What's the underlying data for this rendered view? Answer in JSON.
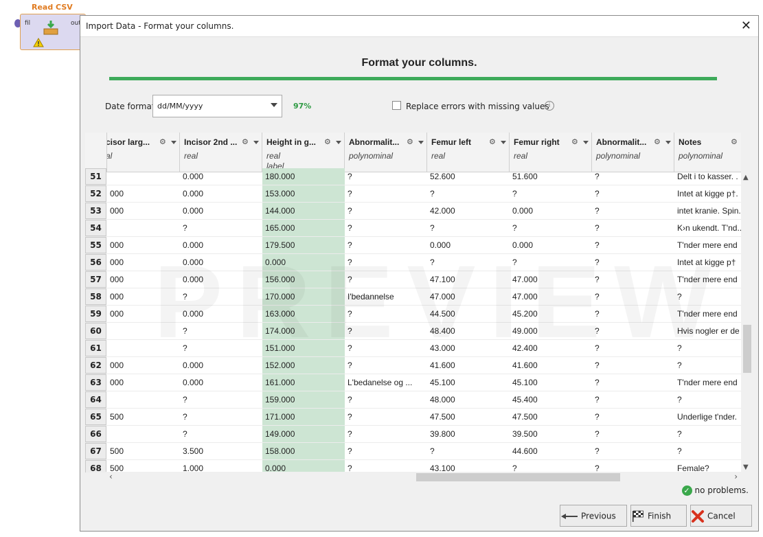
{
  "operator": {
    "title": "Read CSV",
    "port_in": "fil",
    "port_out": "out"
  },
  "dialog": {
    "title": "Import Data - Format your columns.",
    "step_title": "Format your columns.",
    "date_format_label": "Date format",
    "date_format_value": "dd/MM/yyyy",
    "match_percent": "97%",
    "replace_errors_label": "Replace errors with missing values",
    "watermark": "PREVIEW",
    "status_text": "no problems.",
    "buttons": {
      "previous": "Previous",
      "finish": "Finish",
      "cancel": "Cancel"
    }
  },
  "columns": [
    {
      "name": "cisor larg...",
      "type": "al",
      "role": ""
    },
    {
      "name": "Incisor 2nd ...",
      "type": "real",
      "role": ""
    },
    {
      "name": "Height in g...",
      "type": "real",
      "role": "label"
    },
    {
      "name": "Abnormalit...",
      "type": "polynominal",
      "role": ""
    },
    {
      "name": "Femur left",
      "type": "real",
      "role": ""
    },
    {
      "name": "Femur right",
      "type": "real",
      "role": ""
    },
    {
      "name": "Abnormalit...",
      "type": "polynominal",
      "role": ""
    },
    {
      "name": "Notes",
      "type": "polynominal",
      "role": ""
    }
  ],
  "rows": [
    {
      "n": "51",
      "c": [
        "",
        "0.000",
        "180.000",
        "?",
        "52.600",
        "51.600",
        "?",
        "Delt i to kasser. ."
      ]
    },
    {
      "n": "52",
      "c": [
        "000",
        "0.000",
        "153.000",
        "?",
        "?",
        "?",
        "?",
        "Intet at kigge p†. I"
      ]
    },
    {
      "n": "53",
      "c": [
        "000",
        "0.000",
        "144.000",
        "?",
        "42.000",
        "0.000",
        "?",
        "intet kranie. Spin."
      ]
    },
    {
      "n": "54",
      "c": [
        "",
        "?",
        "165.000",
        "?",
        "?",
        "?",
        "?",
        "K›n ukendt. T'nd.."
      ]
    },
    {
      "n": "55",
      "c": [
        "000",
        "0.000",
        "179.500",
        "?",
        "0.000",
        "0.000",
        "?",
        "T'nder mere end"
      ]
    },
    {
      "n": "56",
      "c": [
        "000",
        "0.000",
        "0.000",
        "?",
        "?",
        "?",
        "?",
        "Intet at kigge p†"
      ]
    },
    {
      "n": "57",
      "c": [
        "000",
        "0.000",
        "156.000",
        "?",
        "47.100",
        "47.000",
        "?",
        "T'nder mere end"
      ]
    },
    {
      "n": "58",
      "c": [
        "000",
        "?",
        "170.000",
        "I'bedannelse",
        "47.000",
        "47.000",
        "?",
        "?"
      ]
    },
    {
      "n": "59",
      "c": [
        "000",
        "0.000",
        "163.000",
        "?",
        "44.500",
        "45.200",
        "?",
        "T'nder mere end"
      ]
    },
    {
      "n": "60",
      "c": [
        "",
        "?",
        "174.000",
        "?",
        "48.400",
        "49.000",
        "?",
        "Hvis nogler er de"
      ]
    },
    {
      "n": "61",
      "c": [
        "",
        "?",
        "151.000",
        "?",
        "43.000",
        "42.400",
        "?",
        "?"
      ]
    },
    {
      "n": "62",
      "c": [
        "000",
        "0.000",
        "152.000",
        "?",
        "41.600",
        "41.600",
        "?",
        "?"
      ]
    },
    {
      "n": "63",
      "c": [
        "000",
        "0.000",
        "161.000",
        "L'bedanelse og ...",
        "45.100",
        "45.100",
        "?",
        "T'nder mere end"
      ]
    },
    {
      "n": "64",
      "c": [
        "",
        "?",
        "159.000",
        "?",
        "48.000",
        "45.400",
        "?",
        "?"
      ]
    },
    {
      "n": "65",
      "c": [
        "500",
        "?",
        "171.000",
        "?",
        "47.500",
        "47.500",
        "?",
        "Underlige t'nder."
      ]
    },
    {
      "n": "66",
      "c": [
        "",
        "?",
        "149.000",
        "?",
        "39.800",
        "39.500",
        "?",
        "?"
      ]
    },
    {
      "n": "67",
      "c": [
        "500",
        "3.500",
        "158.000",
        "?",
        "?",
        "44.600",
        "?",
        "?"
      ]
    },
    {
      "n": "68",
      "c": [
        "500",
        "1.000",
        "0.000",
        "?",
        "43.100",
        "?",
        "?",
        "Female?"
      ]
    }
  ]
}
